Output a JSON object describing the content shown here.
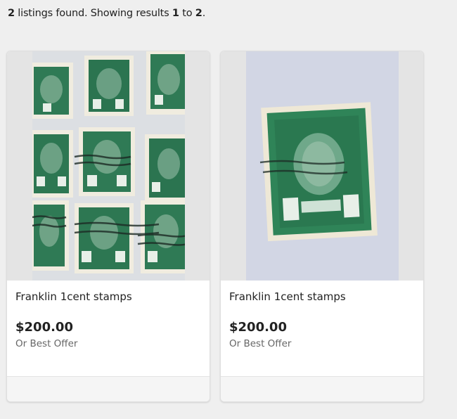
{
  "results": {
    "count": "2",
    "found_text": " listings found.",
    "showing_text": " Showing results ",
    "from": "1",
    "to_word": " to ",
    "to": "2",
    "end": "."
  },
  "listings": [
    {
      "title": "Franklin 1cent stamps",
      "price": "$200.00",
      "offer_text": "Or Best Offer",
      "image_icon": "stamp-sheet-photo"
    },
    {
      "title": "Franklin 1cent stamps",
      "price": "$200.00",
      "offer_text": "Or Best Offer",
      "image_icon": "single-stamp-photo"
    }
  ],
  "colors": {
    "stamp_green": "#2f7a55",
    "background": "#efefef"
  }
}
